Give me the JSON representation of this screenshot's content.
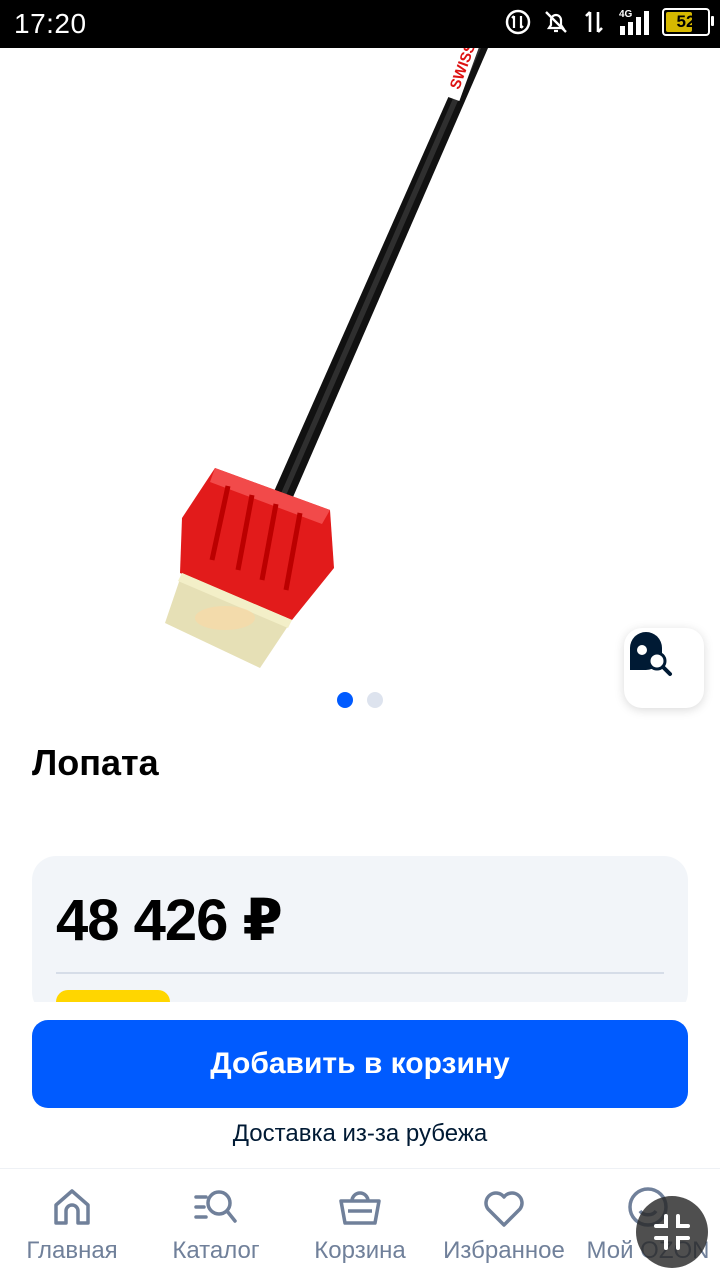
{
  "status_bar": {
    "time": "17:20",
    "network": "4G",
    "battery": "52"
  },
  "gallery": {
    "image_alt": "Лопата",
    "brand_mark": "SWISS",
    "slides_total": 2,
    "active_slide": 1
  },
  "product": {
    "title": "Лопата",
    "price": "48 426 ₽"
  },
  "actions": {
    "add_to_cart": "Добавить в корзину",
    "delivery": "Доставка из-за рубежа"
  },
  "nav": {
    "items": [
      {
        "label": "Главная",
        "icon": "home-icon"
      },
      {
        "label": "Каталог",
        "icon": "catalog-search-icon"
      },
      {
        "label": "Корзина",
        "icon": "basket-icon"
      },
      {
        "label": "Избранное",
        "icon": "heart-icon"
      },
      {
        "label": "Мой OZON",
        "icon": "profile-smile-icon"
      }
    ]
  },
  "colors": {
    "accent": "#005bff",
    "badge": "#ffd600",
    "text": "#001a34",
    "muted": "#70809a"
  }
}
